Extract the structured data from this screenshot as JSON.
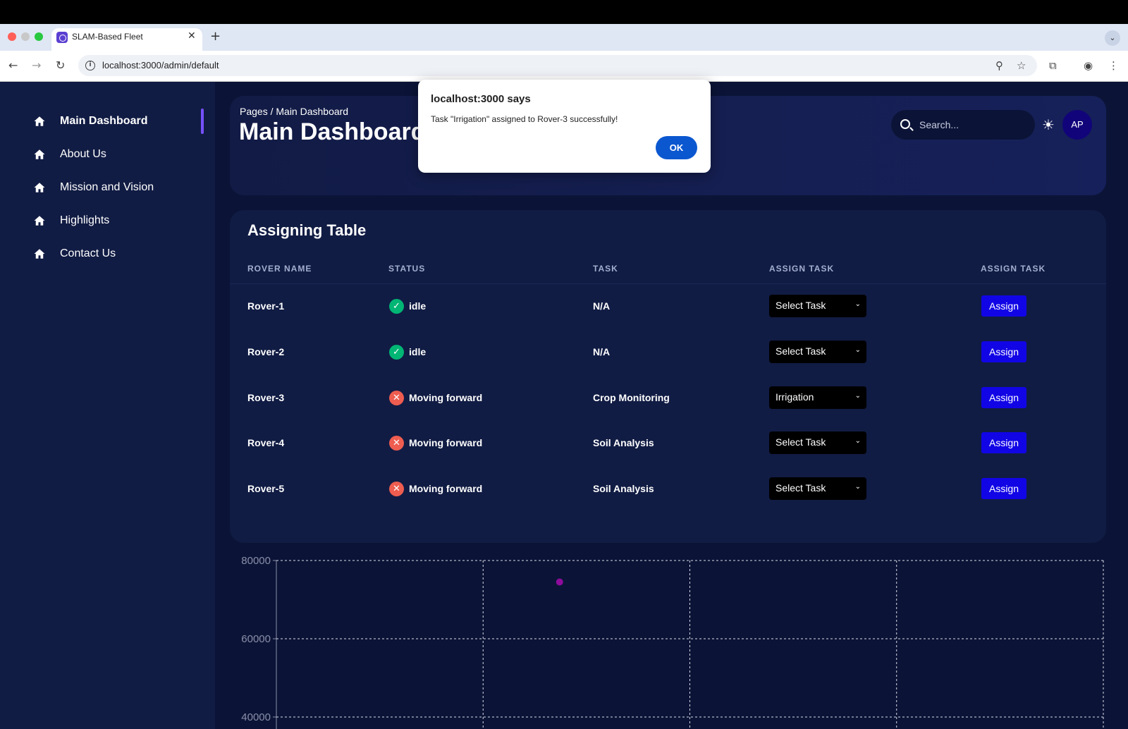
{
  "browser": {
    "tab_title": "SLAM-Based Fleet",
    "url": "localhost:3000/admin/default",
    "tab_close": "✕",
    "new_tab": "+"
  },
  "sidebar": {
    "items": [
      {
        "label": "Main Dashboard",
        "icon": "home-icon",
        "active": true
      },
      {
        "label": "About Us",
        "icon": "home-icon"
      },
      {
        "label": "Mission and Vision",
        "icon": "home-icon"
      },
      {
        "label": "Highlights",
        "icon": "home-icon"
      },
      {
        "label": "Contact Us",
        "icon": "home-icon"
      }
    ]
  },
  "header": {
    "breadcrumb": "Pages  /  Main Dashboard",
    "title": "Main Dashboard",
    "search_placeholder": "Search...",
    "avatar_initials": "AP"
  },
  "table": {
    "title": "Assigning Table",
    "columns": [
      "ROVER NAME",
      "STATUS",
      "TASK",
      "ASSIGN TASK",
      "ASSIGN TASK"
    ],
    "rows": [
      {
        "name": "Rover-1",
        "status": "idle",
        "status_type": "ok",
        "task": "N/A",
        "select": "Select Task",
        "button": "Assign"
      },
      {
        "name": "Rover-2",
        "status": "idle",
        "status_type": "ok",
        "task": "N/A",
        "select": "Select Task",
        "button": "Assign"
      },
      {
        "name": "Rover-3",
        "status": "Moving forward",
        "status_type": "error",
        "task": "Crop Monitoring",
        "select": "Irrigation",
        "button": "Assign"
      },
      {
        "name": "Rover-4",
        "status": "Moving forward",
        "status_type": "error",
        "task": "Soil Analysis",
        "select": "Select Task",
        "button": "Assign"
      },
      {
        "name": "Rover-5",
        "status": "Moving forward",
        "status_type": "error",
        "task": "Soil Analysis",
        "select": "Select Task",
        "button": "Assign"
      }
    ]
  },
  "dialog": {
    "title": "localhost:3000 says",
    "message": "Task \"Irrigation\" assigned to Rover-3 successfully!",
    "ok_label": "OK"
  },
  "chart_data": {
    "type": "scatter",
    "y_ticks": [
      "80000",
      "60000",
      "40000"
    ],
    "ylim": [
      40000,
      80000
    ],
    "points": [
      {
        "x": 1.37,
        "y": 74500
      }
    ],
    "xlim": [
      0,
      4
    ],
    "grid": true,
    "point_color": "#8e0b9b"
  },
  "colors": {
    "background": "#0b1437",
    "card": "#111c44",
    "accent": "#7551ff",
    "button": "#1105e6",
    "ok_status": "#01b574",
    "error_status": "#ee5d50"
  }
}
